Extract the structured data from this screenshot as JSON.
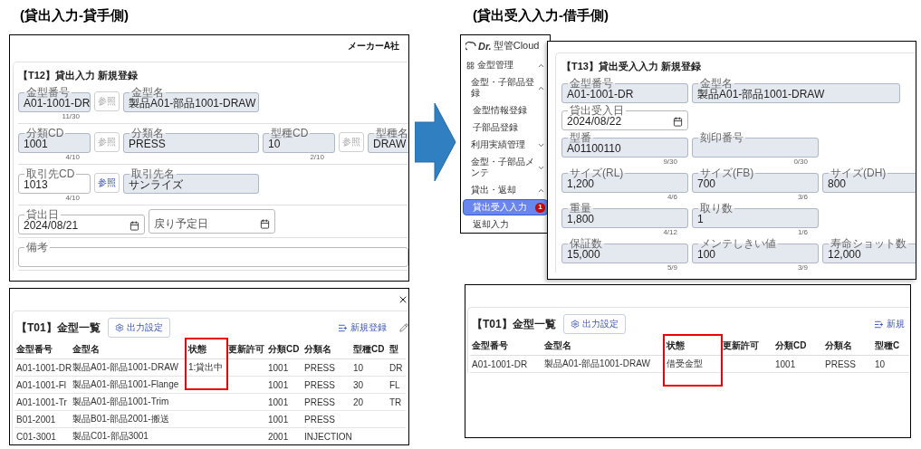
{
  "left": {
    "heading": "(貸出入力-貸手側)",
    "form": {
      "company": "メーカーA社",
      "title": "【T12】貸出入力 新規登録",
      "rows": [
        {
          "items": [
            {
              "kind": "code",
              "label": "金型番号",
              "value": "A01-1001-DR",
              "counter": "11/30",
              "readonly": true
            },
            {
              "kind": "button",
              "label": "参照",
              "disabled": true
            },
            {
              "kind": "name",
              "label": "金型名",
              "value": "製品A01-部品1001-DRAW",
              "readonly": true
            }
          ]
        },
        {
          "items": [
            {
              "kind": "code",
              "label": "分類CD",
              "value": "1001",
              "counter": "4/10",
              "readonly": true
            },
            {
              "kind": "button",
              "label": "参照",
              "disabled": true
            },
            {
              "kind": "name",
              "label": "分類名",
              "value": "PRESS",
              "readonly": true
            },
            {
              "kind": "code",
              "label": "型種CD",
              "value": "10",
              "counter": "2/10",
              "readonly": true
            },
            {
              "kind": "button",
              "label": "参照",
              "disabled": true
            },
            {
              "kind": "name",
              "label": "型種名",
              "value": "DRAW",
              "readonly": true
            }
          ]
        },
        {
          "items": [
            {
              "kind": "code",
              "label": "取引先CD",
              "value": "1013",
              "counter": "4/10",
              "readonly": false
            },
            {
              "kind": "button",
              "label": "参照",
              "disabled": false
            },
            {
              "kind": "name",
              "label": "取引先名",
              "value": "サンライズ",
              "readonly": true
            }
          ]
        },
        {
          "items": [
            {
              "kind": "date",
              "label": "貸出日",
              "value": "2024/08/21",
              "readonly": false
            },
            {
              "kind": "date",
              "placeholder": "戻り予定日",
              "readonly": false
            }
          ]
        },
        {
          "items": [
            {
              "kind": "memo",
              "label": "備考",
              "readonly": false
            }
          ]
        }
      ]
    },
    "list": {
      "title": "【T01】金型一覧",
      "settings_button": "出力設定",
      "new_link": "新規登録",
      "columns": [
        {
          "label": "金型番号",
          "highlighted": false
        },
        {
          "label": "金型名",
          "highlighted": false
        },
        {
          "label": "状態",
          "highlighted": true
        },
        {
          "label": "更新許可",
          "highlighted": false
        },
        {
          "label": "分類CD",
          "highlighted": false
        },
        {
          "label": "分類名",
          "highlighted": false
        },
        {
          "label": "型種CD",
          "highlighted": false
        },
        {
          "label": "型",
          "highlighted": false
        }
      ],
      "rows": [
        [
          "A01-1001-DR",
          "製品A01-部品1001-DRAW",
          "1:貸出中",
          null,
          "1001",
          "PRESS",
          "10",
          "DR"
        ],
        [
          "A01-1001-Fl",
          "製品A01-部品1001-Flange",
          null,
          null,
          "1001",
          "PRESS",
          "30",
          "FL"
        ],
        [
          "A01-1001-Tr",
          "製品A01-部品1001-Trim",
          null,
          null,
          "1001",
          "PRESS",
          "20",
          "TR"
        ],
        [
          "B01-2001",
          "製品B01-部品2001-搬送",
          null,
          null,
          "1001",
          "PRESS",
          null,
          null
        ],
        [
          "C01-3001",
          "製品C01-部品3001",
          null,
          null,
          "2001",
          "INJECTION",
          null,
          null
        ]
      ]
    }
  },
  "right": {
    "heading": "(貸出受入入力-借手側)",
    "sidebar": {
      "logo": {
        "mark": "Dr.",
        "name": "型管Cloud"
      },
      "items": [
        {
          "label": "金型管理",
          "expanded": true,
          "selected": false,
          "children": [
            {
              "label": "金型・子部品登録",
              "expanded": true,
              "selected": false,
              "children": [
                {
                  "label": "金型情報登録",
                  "selected": false
                },
                {
                  "label": "子部品登録",
                  "selected": false
                }
              ]
            },
            {
              "label": "利用実績管理",
              "expanded": false,
              "selected": false
            },
            {
              "label": "金型・子部品メンテ",
              "expanded": false,
              "selected": false
            },
            {
              "label": "貸出・返却",
              "expanded": true,
              "selected": false,
              "children": [
                {
                  "label": "貸出受入入力",
                  "selected": true,
                  "badge": "1"
                },
                {
                  "label": "返却入力",
                  "selected": false
                }
              ]
            }
          ]
        }
      ]
    },
    "form": {
      "title": "【T13】貸出受入入力 新規登録",
      "rows": [
        {
          "items": [
            {
              "kind": "code",
              "label": "金型番号",
              "value": "A01-1001-DR",
              "readonly": true
            },
            {
              "kind": "name",
              "label": "金型名",
              "value": "製品A01-部品1001-DRAW",
              "readonly": true
            }
          ]
        },
        {
          "items": [
            {
              "kind": "date",
              "label": "貸出受入日",
              "value": "2024/08/22",
              "readonly": false
            }
          ]
        },
        {
          "items": [
            {
              "kind": "code",
              "label": "型番",
              "value": "A01100110",
              "counter": "9/30",
              "readonly": true
            },
            {
              "kind": "code",
              "label": "刻印番号",
              "counter": "0/30",
              "readonly": true
            }
          ]
        },
        {
          "items": [
            {
              "kind": "code",
              "label": "サイズ(RL)",
              "value": "1,200",
              "counter": "4/6",
              "readonly": true
            },
            {
              "kind": "code",
              "label": "サイズ(FB)",
              "value": "700",
              "counter": "3/6",
              "readonly": true
            },
            {
              "kind": "code",
              "label": "サイズ(DH)",
              "value": "800",
              "readonly": true
            }
          ]
        },
        {
          "items": [
            {
              "kind": "code",
              "label": "重量",
              "value": "1,800",
              "counter": "4/12",
              "readonly": true
            },
            {
              "kind": "code",
              "label": "取り数",
              "value": "1",
              "counter": "1/6",
              "readonly": true
            }
          ]
        },
        {
          "items": [
            {
              "kind": "code",
              "label": "保証数",
              "value": "15,000",
              "counter": "5/9",
              "readonly": true
            },
            {
              "kind": "code",
              "label": "メンテしきい値",
              "value": "100",
              "counter": "3/9",
              "readonly": true
            },
            {
              "kind": "code",
              "label": "寿命ショット数",
              "value": "12,000",
              "readonly": true
            }
          ]
        }
      ]
    },
    "list": {
      "title": "【T01】金型一覧",
      "settings_button": "出力設定",
      "new_link": "新規",
      "columns": [
        {
          "label": "金型番号",
          "highlighted": false
        },
        {
          "label": "金型名",
          "highlighted": false
        },
        {
          "label": "状態",
          "highlighted": true
        },
        {
          "label": "更新許可",
          "highlighted": false
        },
        {
          "label": "分類CD",
          "highlighted": false
        },
        {
          "label": "分類名",
          "highlighted": false
        },
        {
          "label": "型種C",
          "highlighted": false
        }
      ],
      "rows": [
        [
          "A01-1001-DR",
          "製品A01-部品1001-DRAW",
          "借受金型",
          null,
          "1001",
          "PRESS",
          "10"
        ]
      ]
    }
  }
}
